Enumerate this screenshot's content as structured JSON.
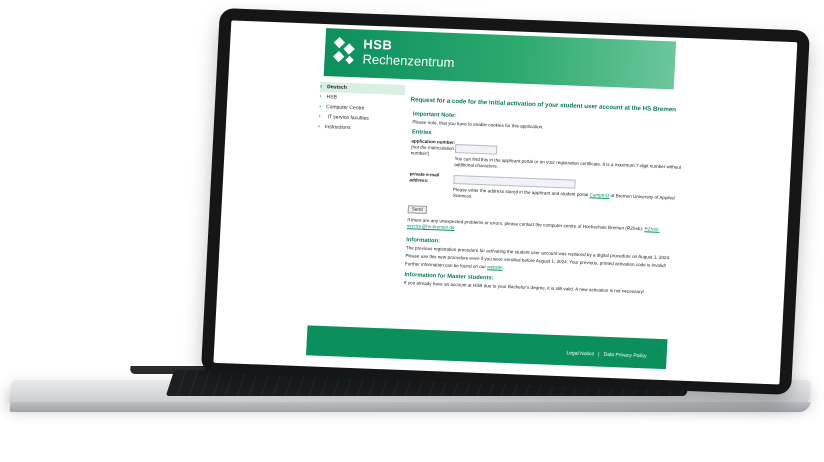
{
  "header": {
    "brand": "HSB",
    "subtitle": "Rechenzentrum"
  },
  "nav": {
    "items": [
      {
        "label": "Deutsch",
        "active": true
      },
      {
        "label": "HSB"
      },
      {
        "label": "Computer Centre"
      },
      {
        "label": "IT service faculties"
      },
      {
        "label": "Instructions"
      }
    ]
  },
  "content": {
    "title": "Request for a code for the initial activation of your student user account at the HS Bremen",
    "important_heading": "Important Note:",
    "important_text": "Please note, that you have to enable cookies for this application.",
    "entries_heading": "Entries",
    "app_number_label": "application number:",
    "app_number_sublabel": "(not the matriculation number!)",
    "app_number_hint": "You can find this in the applicant portal or on your registration certificate. It is a maximum 7-digit number without additional characters.",
    "email_label": "private e-mail address:",
    "email_hint_before": "Please enter the address stored in the applicant and student portal ",
    "email_hint_link": "CampInO",
    "email_hint_after": " of Bremen University of Applied Sciences.",
    "send_label": "Send",
    "problems_text": "If there are any unexpected problems or errors, please contact the computer centre of Hochschule Bremen (RZhsb): ",
    "problems_link": "RZhsb-service@hs-bremen.de",
    "info_heading": "Information:",
    "info_1": "The previous registration procedure for activating the student user account was replaced by a digital procedure on August 1, 2024.",
    "info_2": "Please use this new procedure even if you were enrolled before August 1, 2024. Your previous, printed activation code is invalid!",
    "info_3_before": "Further information can be found on our ",
    "info_3_link": "website",
    "info_3_after": ".",
    "master_heading": "Information for Master students:",
    "master_text": "If you already have an account at HSB due to your Bachelor's degree, it is still valid. A new activation is not necessary!"
  },
  "footer": {
    "legal": "Legal Notice",
    "sep": "|",
    "privacy": "Data Privacy Policy"
  },
  "colors": {
    "brand_green": "#0b8f5c",
    "heading_green": "#0b7a4e"
  }
}
